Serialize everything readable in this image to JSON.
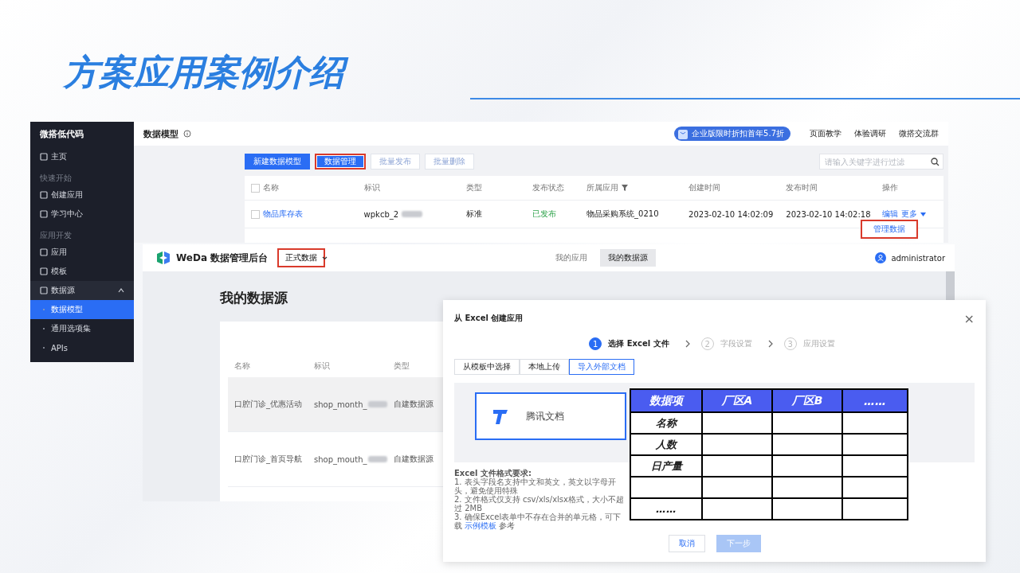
{
  "title": "方案应用案例介绍",
  "data_model_screen": {
    "sidebar": {
      "brand": "微搭低代码",
      "items": [
        {
          "kind": "item",
          "label": "主页",
          "selected": false
        },
        {
          "kind": "section",
          "label": "快速开始"
        },
        {
          "kind": "item",
          "label": "创建应用",
          "selected": false
        },
        {
          "kind": "item",
          "label": "学习中心",
          "selected": false
        },
        {
          "kind": "section",
          "label": "应用开发"
        },
        {
          "kind": "item",
          "label": "应用",
          "selected": false
        },
        {
          "kind": "item",
          "label": "模板",
          "selected": false
        },
        {
          "kind": "group",
          "label": "数据源",
          "selected": false,
          "expanded": true
        },
        {
          "kind": "subitem",
          "label": "数据模型",
          "selected": true
        },
        {
          "kind": "subitem",
          "label": "通用选项集",
          "selected": false
        },
        {
          "kind": "subitem",
          "label": "APIs",
          "selected": false
        }
      ]
    },
    "header": {
      "title": "数据模型",
      "promo": "企业版限时折扣首年5.7折",
      "links": [
        "页面教学",
        "体验调研",
        "微搭交流群"
      ]
    },
    "toolbar": {
      "buttons": [
        {
          "label": "新建数据模型",
          "disabled": false,
          "highlighted": false
        },
        {
          "label": "数据管理",
          "disabled": false,
          "highlighted": true
        },
        {
          "label": "批量发布",
          "disabled": true,
          "highlighted": false
        },
        {
          "label": "批量删除",
          "disabled": true,
          "highlighted": false
        }
      ],
      "search": {
        "placeholder": "请输入关键字进行过滤"
      }
    },
    "table": {
      "columns": [
        "名称",
        "标识",
        "类型",
        "发布状态",
        "所属应用",
        "创建时间",
        "发布时间",
        "操作"
      ],
      "all_checked": false,
      "rows": [
        {
          "checked": false,
          "name": "物品库存表",
          "id": "wpkcb_2",
          "type": "标准",
          "status": "已发布",
          "app": "物品采购系统_0210",
          "created": "2023-02-10 14:02:09",
          "published": "2023-02-10 14:02:18",
          "actions": [
            "编辑",
            "更多"
          ]
        }
      ]
    },
    "more_menu": {
      "items": [
        {
          "label": "管理数据",
          "highlighted": true
        }
      ]
    }
  },
  "weda_screen": {
    "logo": "WeDa 数据管理后台",
    "env_dropdown": {
      "value": "正式数据",
      "highlighted": true
    },
    "tabs": [
      {
        "label": "我的应用",
        "selected": false
      },
      {
        "label": "我的数据源",
        "selected": true
      }
    ],
    "user": "administrator",
    "heading": "我的数据源",
    "table": {
      "columns": [
        "名称",
        "标识",
        "类型"
      ],
      "rows": [
        {
          "name": "口腔门诊_优惠活动",
          "id": "shop_month_",
          "type": "自建数据源",
          "selected": true
        },
        {
          "name": "口腔门诊_首页导航",
          "id": "shop_mouth_",
          "type": "自建数据源",
          "selected": false
        }
      ]
    }
  },
  "excel_dialog": {
    "title": "从 Excel 创建应用",
    "close": "×",
    "steps": [
      {
        "number": "1",
        "label": "选择 Excel 文件",
        "selected": true
      },
      {
        "number": "2",
        "label": "字段设置",
        "selected": false
      },
      {
        "number": "3",
        "label": "应用设置",
        "selected": false
      }
    ],
    "tabs": [
      {
        "label": "从模板中选择",
        "selected": false
      },
      {
        "label": "本地上传",
        "selected": false
      },
      {
        "label": "导入外部文档",
        "selected": true
      }
    ],
    "source": {
      "label": "腾讯文档",
      "selected": true
    },
    "requirements": {
      "heading": "Excel 文件格式要求:",
      "lines": [
        "1. 表头字段名支持中文和英文，英文以字母开头，避免使用特殊",
        "2. 文件格式仅支持 csv/xls/xlsx格式，大小不超过 2MB"
      ],
      "last_line": {
        "before": "3. 确保Excel表单中不存在合并的单元格，可下载",
        "link": "示例模板",
        "after": "参考"
      }
    },
    "buttons": [
      {
        "label": "取消",
        "disabled": false
      },
      {
        "label": "下一步",
        "disabled": true
      }
    ]
  },
  "overlay_table": {
    "columns": [
      "数据项",
      "厂区A",
      "厂区B",
      "……"
    ],
    "rows": [
      {
        "label": "名称"
      },
      {
        "label": "人数"
      },
      {
        "label": "日产量"
      },
      {},
      {
        "label": "……"
      }
    ]
  }
}
